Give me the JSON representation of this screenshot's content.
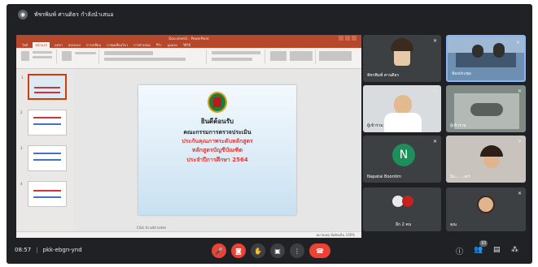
{
  "meeting": {
    "presenter_label": "พัชรพิมพ์ ศานติธร กำลังนำเสนอ",
    "time": "08:57",
    "separator": "|",
    "code": "pkk-ebgn-ynd"
  },
  "powerpoint": {
    "doc_title": "Document1 - PowerPoint",
    "tabs": [
      "ไฟล์",
      "หน้าแรก",
      "แทรก",
      "ออกแบบ",
      "การเปลี่ยน",
      "ภาพเคลื่อนไหว",
      "การนำเสนอ",
      "รีวิว",
      "มุมมอง",
      "วิธีใช้"
    ],
    "notes_hint": "Click to add notes",
    "status_text": "หมายเหตุ  ข้อคิดเห็น  100%",
    "slide_numbers": [
      "1",
      "2",
      "3",
      "4"
    ]
  },
  "slide": {
    "line1": "ยินดีต้อนรับ",
    "line2": "คณะกรรมการตรวจประเมิน",
    "line3": "ประกันคุณภาพระดับหลักสูตร",
    "line4": "หลักสูตรบัญชีบัณฑิต",
    "line5": "ประจำปีการศึกษา 2564"
  },
  "participants": [
    {
      "name": "พัชรพิมพ์ ศานติธร"
    },
    {
      "name": "ห้องประชุม"
    },
    {
      "name": "ผู้เข้าร่วม"
    },
    {
      "name": "ผู้เข้าร่วม"
    },
    {
      "name": "Napatai Boontim",
      "initial": "N"
    },
    {
      "name": "Su... ...art"
    },
    {
      "name": "อีก 2 คน"
    },
    {
      "name": "คุณ"
    }
  ],
  "bottom": {
    "participant_count": "10"
  },
  "colors": {
    "background": "#202124",
    "tile": "#3c4043",
    "powerpoint_red": "#b7472a",
    "end_call": "#ea4335",
    "avatar_green": "#1e8e5a"
  }
}
